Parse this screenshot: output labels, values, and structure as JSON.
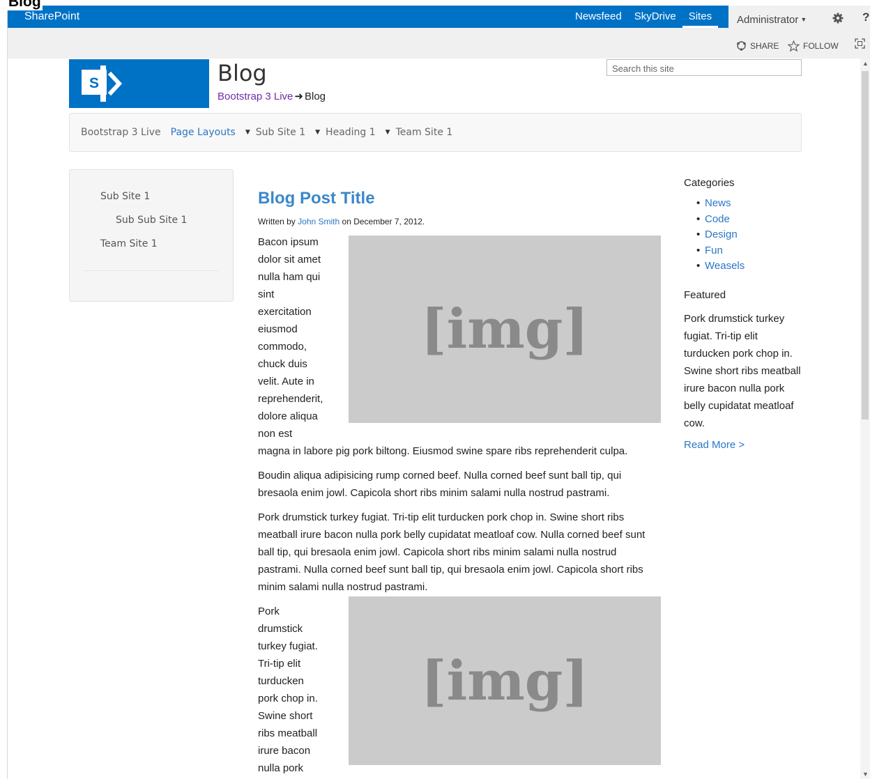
{
  "page_label": "Blog",
  "suite_bar": {
    "brand": "SharePoint",
    "nav": [
      "Newsfeed",
      "SkyDrive",
      "Sites"
    ],
    "user": "Administrator",
    "help": "?"
  },
  "ribbon": {
    "share": "SHARE",
    "follow": "FOLLOW"
  },
  "header": {
    "title": "Blog",
    "breadcrumb_link": "Bootstrap 3 Live",
    "breadcrumb_current": "Blog",
    "search_placeholder": "Search this site"
  },
  "topnav": {
    "items": [
      "Bootstrap 3 Live",
      "Page Layouts",
      "Sub Site 1",
      "Heading 1",
      "Team Site 1"
    ]
  },
  "sidenav": {
    "items": [
      "Sub Site 1",
      "Sub Sub Site 1",
      "Team Site 1"
    ]
  },
  "post": {
    "title": "Blog Post Title",
    "written_by": "Written by",
    "author": "John Smith",
    "date_text": "on December 7, 2012.",
    "image_label": "[img]",
    "p1_lines": [
      "Bacon ipsum",
      "dolor sit amet",
      "nulla ham qui",
      "sint",
      "exercitation",
      "eiusmod",
      "commodo,",
      "chuck duis",
      "velit. Aute in",
      "reprehenderit,",
      "dolore aliqua",
      "non est"
    ],
    "p1_tail": "magna in labore pig pork biltong. Eiusmod swine spare ribs reprehenderit culpa.",
    "p2": "Boudin aliqua adipisicing rump corned beef. Nulla corned beef sunt ball tip, qui bresaola enim jowl. Capicola short ribs minim salami nulla nostrud pastrami.",
    "p3": "Pork drumstick turkey fugiat. Tri-tip elit turducken pork chop in. Swine short ribs meatball irure bacon nulla pork belly cupidatat meatloaf cow. Nulla corned beef sunt ball tip, qui bresaola enim jowl. Capicola short ribs minim salami nulla nostrud pastrami. Nulla corned beef sunt ball tip, qui bresaola enim jowl. Capicola short ribs minim salami nulla nostrud pastrami.",
    "p4_lines": [
      "Pork",
      "drumstick",
      "turkey fugiat.",
      "Tri-tip elit",
      "turducken",
      "pork chop in.",
      "Swine short",
      "ribs meatball",
      "irure bacon",
      "nulla pork"
    ]
  },
  "sidebar": {
    "categories_heading": "Categories",
    "categories": [
      "News",
      "Code",
      "Design",
      "Fun",
      "Weasels"
    ],
    "featured_heading": "Featured",
    "featured_text": "Pork drumstick turkey fugiat. Tri-tip elit turducken pork chop in. Swine short ribs meatball irure bacon nulla pork belly cupidatat meatloaf cow.",
    "read_more": "Read More >"
  },
  "colors": {
    "suite_blue": "#0072c6",
    "link_blue": "#2a76c6",
    "visited_purple": "#6f2da8",
    "image_gray": "#cbcbcb"
  }
}
